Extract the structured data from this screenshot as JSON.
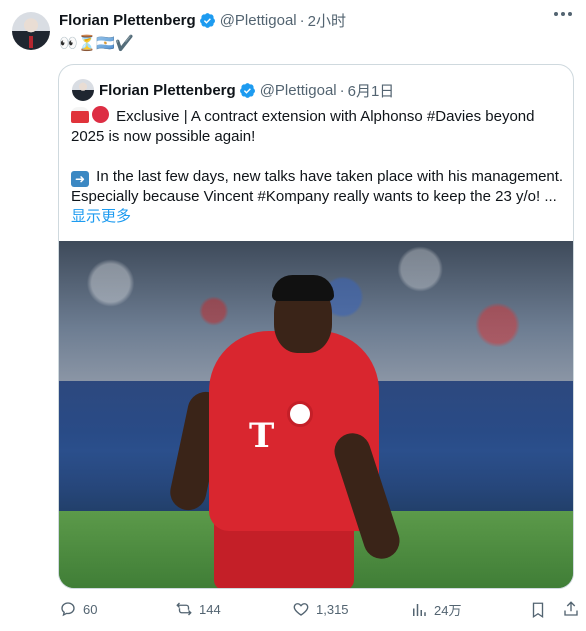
{
  "author": {
    "name": "Florian Plettenberg",
    "handle": "@Plettigoal",
    "time": "2小时"
  },
  "tweet_text": "👀⏳🇦🇷✔️",
  "quoted": {
    "name": "Florian Plettenberg",
    "handle": "@Plettigoal",
    "date": "6月1日",
    "line1": "Exclusive | A contract extension with Alphonso #Davies beyond",
    "line2": "2025 is now possible again!",
    "line3": "In the last few days, new talks have taken place with his management.",
    "line4": "Especially because Vincent #Kompany really wants to keep the 23 y/o! ...",
    "show_more": "显示更多",
    "photo_text": "T"
  },
  "actions": {
    "replies": "60",
    "reposts": "144",
    "likes": "1,315",
    "views": "24万"
  },
  "colors": {
    "accent": "#1d9bf0",
    "muted": "#536471",
    "border": "#cfd9de"
  }
}
